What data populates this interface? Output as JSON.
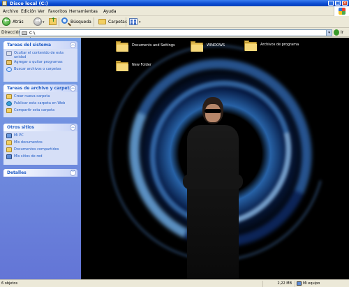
{
  "window": {
    "title": "Disco local (C:)"
  },
  "menu": [
    "Archivo",
    "Edición",
    "Ver",
    "Favoritos",
    "Herramientas",
    "Ayuda"
  ],
  "toolbar": {
    "back": "Atrás",
    "search": "Búsqueda",
    "folders": "Carpetas"
  },
  "address": {
    "label": "Dirección",
    "value": "C:\\",
    "go": "Ir"
  },
  "panels": {
    "system": {
      "title": "Tareas del sistema",
      "items": [
        "Ocultar el contenido de esta unidad",
        "Agregar o quitar programas",
        "Buscar archivos o carpetas"
      ]
    },
    "files": {
      "title": "Tareas de archivo y carpeta",
      "items": [
        "Crear nueva carpeta",
        "Publicar esta carpeta en Web",
        "Compartir esta carpeta"
      ]
    },
    "places": {
      "title": "Otros sitios",
      "items": [
        "Mi PC",
        "Mis documentos",
        "Documentos compartidos",
        "Mis sitios de red"
      ]
    },
    "details": {
      "title": "Detalles"
    }
  },
  "files": [
    "Documents and Settings",
    "WINDOWS",
    "Archivos de programa",
    "New Folder"
  ],
  "status": {
    "objects": "6 objetos",
    "size": "2,22 MB",
    "location": "Mi equipo"
  },
  "colors": {
    "titlebar": "#0a4bd0",
    "sidebar": "#6f8bdc",
    "panel_title": "#215dc6",
    "background_glow": "#3c96ff"
  }
}
